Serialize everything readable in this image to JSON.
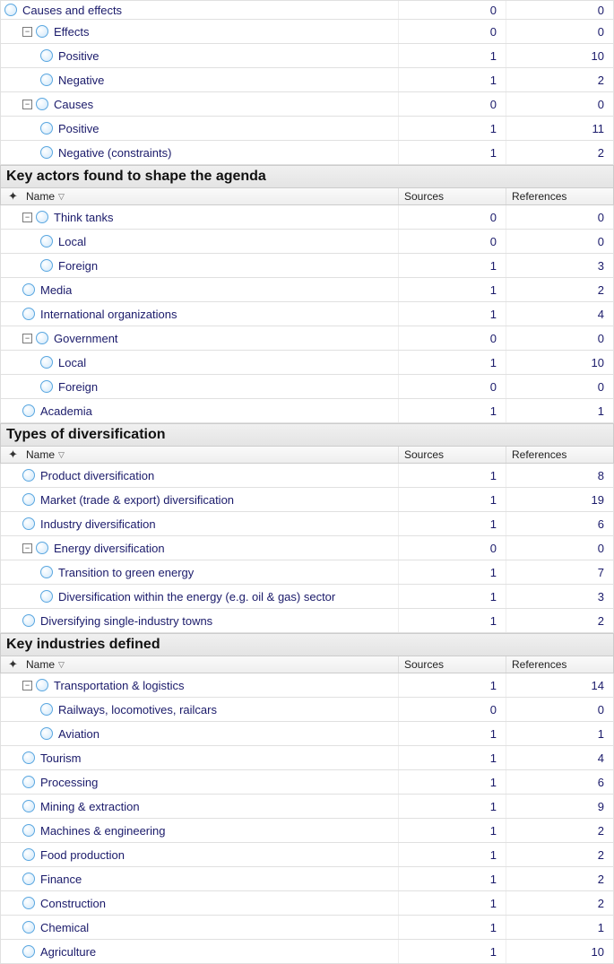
{
  "headers": {
    "name": "Name",
    "sources": "Sources",
    "references": "References"
  },
  "expander": {
    "minus": "−",
    "plus": "+"
  },
  "sections": [
    {
      "id": "causes-effects",
      "title": null,
      "showColHeader": false,
      "rows": [
        {
          "depth": 0,
          "expander": null,
          "icon": true,
          "label": "Causes and effects",
          "sources": 0,
          "references": 0
        },
        {
          "depth": 1,
          "expander": "minus",
          "icon": true,
          "label": "Effects",
          "sources": 0,
          "references": 0
        },
        {
          "depth": 2,
          "expander": null,
          "icon": true,
          "label": "Positive",
          "sources": 1,
          "references": 10
        },
        {
          "depth": 2,
          "expander": null,
          "icon": true,
          "label": "Negative",
          "sources": 1,
          "references": 2
        },
        {
          "depth": 1,
          "expander": "minus",
          "icon": true,
          "label": "Causes",
          "sources": 0,
          "references": 0
        },
        {
          "depth": 2,
          "expander": null,
          "icon": true,
          "label": "Positive",
          "sources": 1,
          "references": 11
        },
        {
          "depth": 2,
          "expander": null,
          "icon": true,
          "label": "Negative (constraints)",
          "sources": 1,
          "references": 2
        }
      ]
    },
    {
      "id": "key-actors",
      "title": "Key actors found to shape the agenda",
      "showColHeader": true,
      "rows": [
        {
          "depth": 1,
          "expander": "minus",
          "icon": true,
          "label": "Think tanks",
          "sources": 0,
          "references": 0
        },
        {
          "depth": 2,
          "expander": null,
          "icon": true,
          "label": "Local",
          "sources": 0,
          "references": 0
        },
        {
          "depth": 2,
          "expander": null,
          "icon": true,
          "label": "Foreign",
          "sources": 1,
          "references": 3
        },
        {
          "depth": 1,
          "expander": null,
          "icon": true,
          "label": "Media",
          "sources": 1,
          "references": 2
        },
        {
          "depth": 1,
          "expander": null,
          "icon": true,
          "label": "International organizations",
          "sources": 1,
          "references": 4
        },
        {
          "depth": 1,
          "expander": "minus",
          "icon": true,
          "label": "Government",
          "sources": 0,
          "references": 0
        },
        {
          "depth": 2,
          "expander": null,
          "icon": true,
          "label": "Local",
          "sources": 1,
          "references": 10
        },
        {
          "depth": 2,
          "expander": null,
          "icon": true,
          "label": "Foreign",
          "sources": 0,
          "references": 0
        },
        {
          "depth": 1,
          "expander": null,
          "icon": true,
          "label": "Academia",
          "sources": 1,
          "references": 1
        }
      ]
    },
    {
      "id": "types-diversification",
      "title": "Types of diversification",
      "showColHeader": true,
      "rows": [
        {
          "depth": 1,
          "expander": null,
          "icon": true,
          "label": "Product diversification",
          "sources": 1,
          "references": 8
        },
        {
          "depth": 1,
          "expander": null,
          "icon": true,
          "label": "Market (trade & export) diversification",
          "sources": 1,
          "references": 19
        },
        {
          "depth": 1,
          "expander": null,
          "icon": true,
          "label": "Industry diversification",
          "sources": 1,
          "references": 6
        },
        {
          "depth": 1,
          "expander": "minus",
          "icon": true,
          "label": "Energy diversification",
          "sources": 0,
          "references": 0
        },
        {
          "depth": 2,
          "expander": null,
          "icon": true,
          "label": "Transition to green energy",
          "sources": 1,
          "references": 7
        },
        {
          "depth": 2,
          "expander": null,
          "icon": true,
          "label": "Diversification within the energy (e.g. oil & gas) sector",
          "sources": 1,
          "references": 3
        },
        {
          "depth": 1,
          "expander": null,
          "icon": true,
          "label": "Diversifying single-industry towns",
          "sources": 1,
          "references": 2
        }
      ]
    },
    {
      "id": "key-industries",
      "title": "Key industries defined",
      "showColHeader": true,
      "rows": [
        {
          "depth": 1,
          "expander": "minus",
          "icon": true,
          "label": "Transportation & logistics",
          "sources": 1,
          "references": 14
        },
        {
          "depth": 2,
          "expander": null,
          "icon": true,
          "label": "Railways, locomotives, railcars",
          "sources": 0,
          "references": 0
        },
        {
          "depth": 2,
          "expander": null,
          "icon": true,
          "label": "Aviation",
          "sources": 1,
          "references": 1
        },
        {
          "depth": 1,
          "expander": null,
          "icon": true,
          "label": "Tourism",
          "sources": 1,
          "references": 4
        },
        {
          "depth": 1,
          "expander": null,
          "icon": true,
          "label": "Processing",
          "sources": 1,
          "references": 6
        },
        {
          "depth": 1,
          "expander": null,
          "icon": true,
          "label": "Mining & extraction",
          "sources": 1,
          "references": 9
        },
        {
          "depth": 1,
          "expander": null,
          "icon": true,
          "label": "Machines & engineering",
          "sources": 1,
          "references": 2
        },
        {
          "depth": 1,
          "expander": null,
          "icon": true,
          "label": "Food production",
          "sources": 1,
          "references": 2
        },
        {
          "depth": 1,
          "expander": null,
          "icon": true,
          "label": "Finance",
          "sources": 1,
          "references": 2
        },
        {
          "depth": 1,
          "expander": null,
          "icon": true,
          "label": "Construction",
          "sources": 1,
          "references": 2
        },
        {
          "depth": 1,
          "expander": null,
          "icon": true,
          "label": "Chemical",
          "sources": 1,
          "references": 1
        },
        {
          "depth": 1,
          "expander": null,
          "icon": true,
          "label": "Agriculture",
          "sources": 1,
          "references": 10
        }
      ]
    }
  ]
}
